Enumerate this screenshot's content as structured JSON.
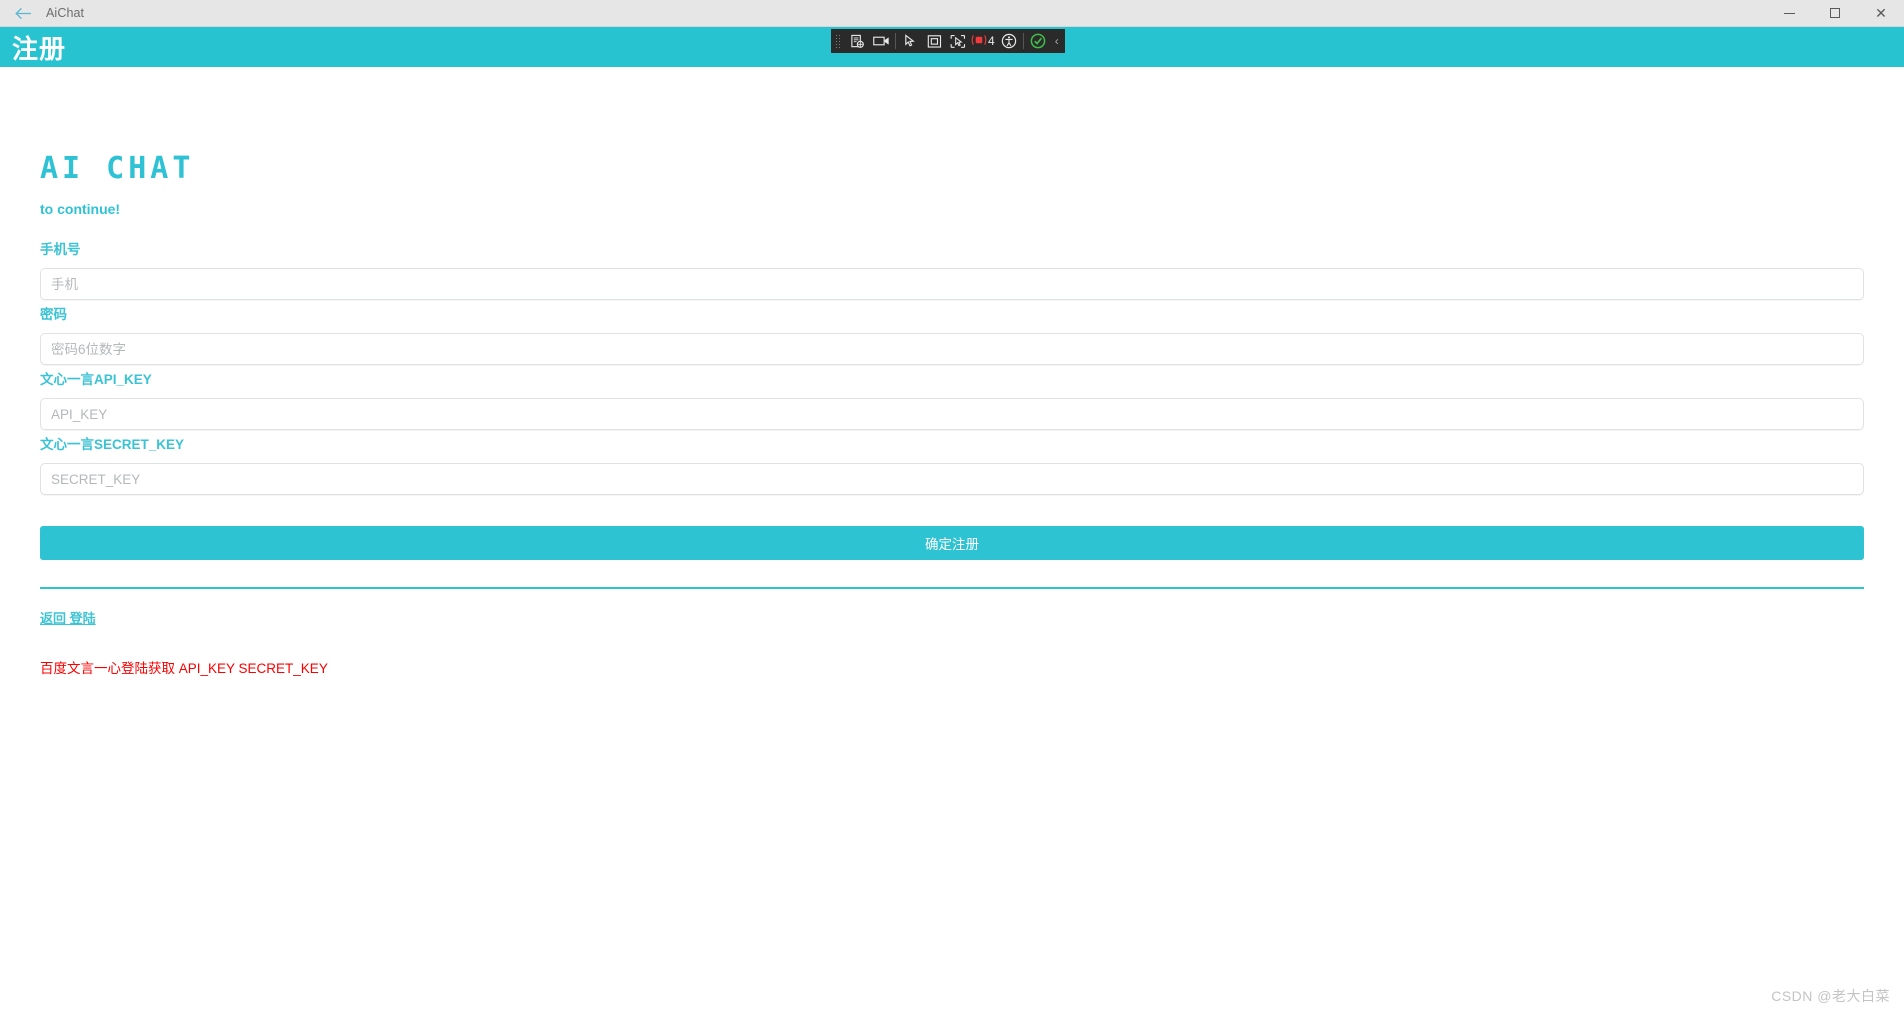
{
  "window": {
    "title": "AiChat",
    "back_icon": "back-arrow-icon",
    "controls": {
      "minimize": "minimize-icon",
      "maximize": "maximize-icon",
      "close": "close-icon"
    }
  },
  "app_header": {
    "title": "注册"
  },
  "capture_toolbar": {
    "grip": "drag-grip-icon",
    "items": [
      {
        "name": "screenshot-icon"
      },
      {
        "name": "record-video-icon"
      },
      {
        "name": "pointer-icon"
      },
      {
        "name": "region-frame-icon"
      },
      {
        "name": "pointer-region-icon"
      }
    ],
    "counter": {
      "icon": "record-indicator-icon",
      "value": "4"
    },
    "accessibility_icon": "accessibility-icon",
    "confirm_icon": "check-circle-icon",
    "collapse_icon": "chevron-left-icon"
  },
  "form": {
    "brand": "AI CHAT",
    "subtitle": "to continue!",
    "fields": [
      {
        "label": "手机号",
        "placeholder": "手机",
        "value": "",
        "type": "tel"
      },
      {
        "label": "密码",
        "placeholder": "密码6位数字",
        "value": "",
        "type": "password"
      },
      {
        "label": "文心一言API_KEY",
        "placeholder": "API_KEY",
        "value": "",
        "type": "text"
      },
      {
        "label": "文心一言SECRET_KEY",
        "placeholder": "SECRET_KEY",
        "value": "",
        "type": "text"
      }
    ],
    "submit_label": "确定注册",
    "back_login_label": "返回 登陆",
    "baidu_link_label": "百度文言一心登陆获取 API_KEY SECRET_KEY"
  },
  "watermark": "CSDN @老大白菜",
  "colors": {
    "accent": "#28c3d1",
    "accent_text": "#3ac3d4",
    "danger": "#fb0000",
    "titlebar_bg": "#e6e6e6",
    "toolbar_bg": "#2a2a2a",
    "input_border": "#dfe2e5"
  }
}
